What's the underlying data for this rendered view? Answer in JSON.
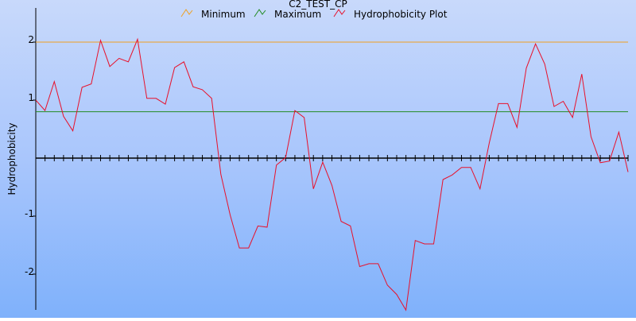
{
  "chart_data": {
    "type": "line",
    "title": "C2_TEST_CP",
    "ylabel": "Hydrophobicity",
    "xlabel": "",
    "ylim": [
      -2.6,
      2.6
    ],
    "y_ticks": [
      {
        "value": 2,
        "label": "2"
      },
      {
        "value": 1,
        "label": "1"
      },
      {
        "value": -1,
        "label": "-1"
      },
      {
        "value": -2,
        "label": "-2"
      }
    ],
    "legend_position": "top-center",
    "series": [
      {
        "name": "Minimum",
        "color": "#f0a020",
        "kind": "hline",
        "y": 2.0
      },
      {
        "name": "Maximum",
        "color": "#228b22",
        "kind": "hline",
        "y": 0.8
      },
      {
        "name": "Hydrophobicity Plot",
        "color": "#e8102a",
        "kind": "line",
        "values": [
          1.0,
          0.82,
          1.32,
          0.72,
          0.47,
          1.22,
          1.28,
          2.03,
          1.58,
          1.72,
          1.66,
          2.05,
          1.03,
          1.03,
          0.93,
          1.56,
          1.66,
          1.23,
          1.18,
          1.03,
          -0.28,
          -0.98,
          -1.55,
          -1.55,
          -1.17,
          -1.19,
          -0.12,
          0.01,
          0.82,
          0.7,
          -0.53,
          -0.07,
          -0.47,
          -1.09,
          -1.17,
          -1.87,
          -1.82,
          -1.82,
          -2.19,
          -2.35,
          -2.62,
          -1.42,
          -1.48,
          -1.48,
          -0.37,
          -0.29,
          -0.16,
          -0.16,
          -0.53,
          0.26,
          0.94,
          0.94,
          0.53,
          1.55,
          1.97,
          1.62,
          0.89,
          0.98,
          0.7,
          1.45,
          0.37,
          -0.08,
          -0.05,
          0.45,
          -0.24
        ]
      }
    ]
  }
}
